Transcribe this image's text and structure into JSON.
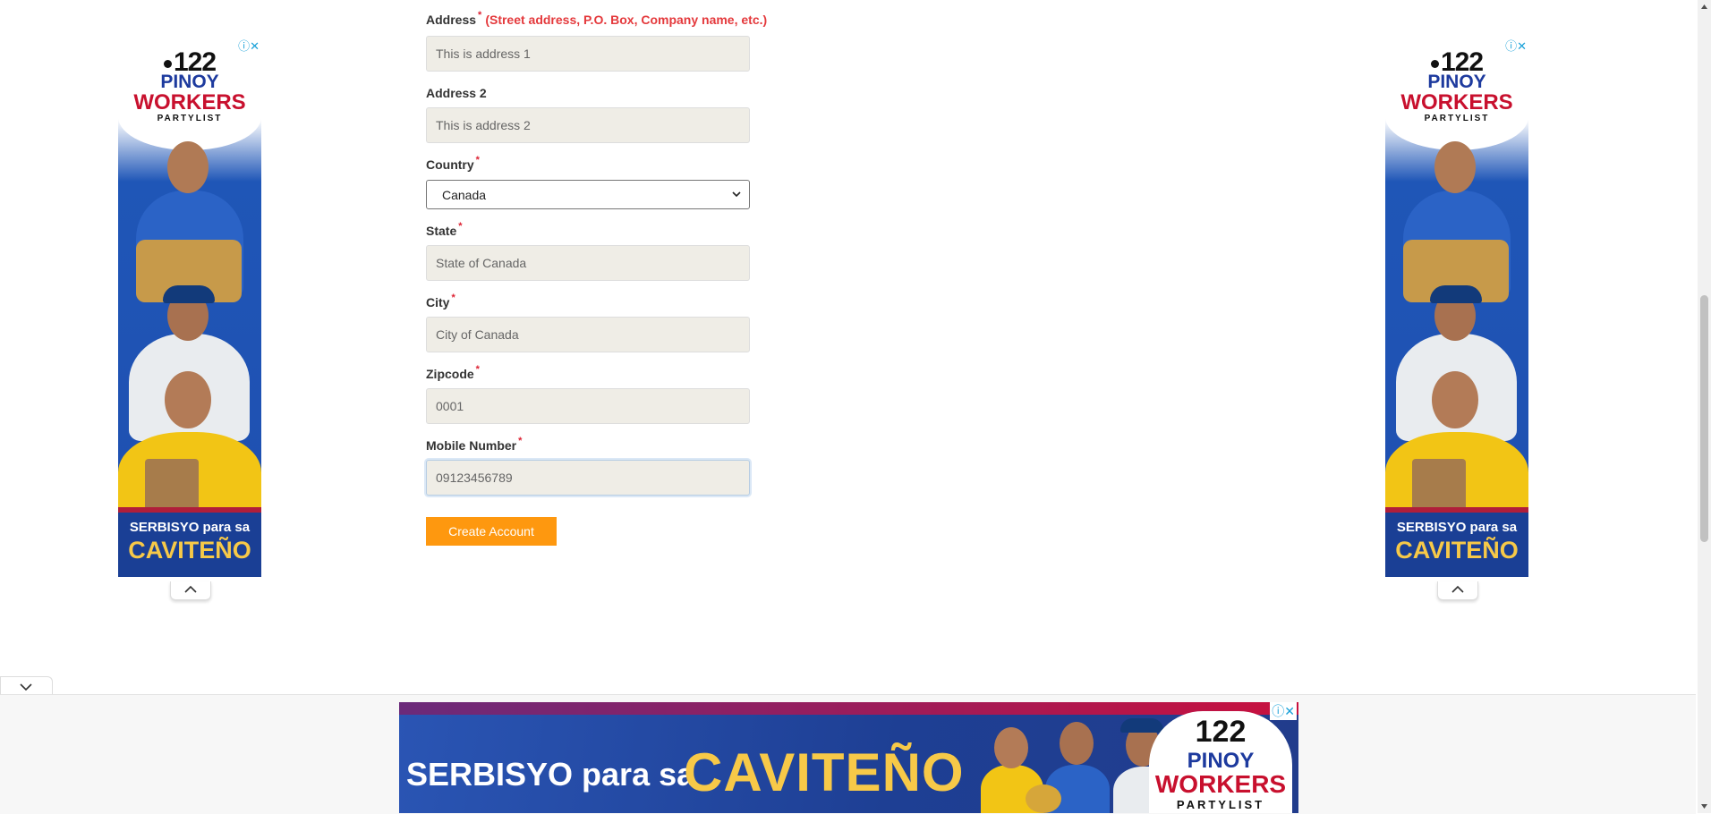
{
  "form": {
    "address": {
      "label": "Address",
      "required": "*",
      "hint": "(Street address, P.O. Box, Company name, etc.)",
      "value": "This is address 1"
    },
    "address2": {
      "label": "Address 2",
      "value": "This is address 2"
    },
    "country": {
      "label": "Country",
      "required": "*",
      "selected": "Canada"
    },
    "state": {
      "label": "State",
      "required": "*",
      "value": "State of Canada"
    },
    "city": {
      "label": "City",
      "required": "*",
      "value": "City of Canada"
    },
    "zipcode": {
      "label": "Zipcode",
      "required": "*",
      "value": "0001"
    },
    "mobile": {
      "label": "Mobile Number",
      "required": "*",
      "value": "09123456789"
    },
    "submit_label": "Create Account"
  },
  "ads": {
    "side": {
      "number": "122",
      "name_line1": "PINOY",
      "name_line2": "WORKERS",
      "name_line3": "PARTYLIST",
      "tagline": "SERBISYO para sa",
      "tagline_big": "CAVITEÑO"
    },
    "banner": {
      "tagline": "SERBISYO para sa",
      "tagline_big": "CAVITEÑO",
      "number": "122",
      "name_line1": "PINOY",
      "name_line2": "WORKERS",
      "name_line3": "PARTYLIST"
    },
    "icons": [
      "info-icon",
      "close-icon"
    ]
  },
  "colors": {
    "accent": "#fe980f",
    "hint_red": "#e4393c",
    "input_bg": "#efede6",
    "ad_blue": "#1f4fb0",
    "ad_red": "#c8102e",
    "ad_gold": "#f7c948"
  }
}
